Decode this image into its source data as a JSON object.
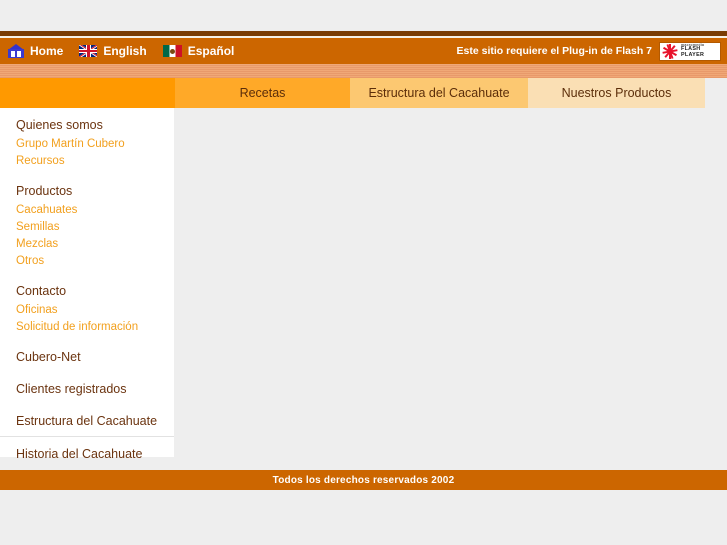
{
  "header": {
    "home_label": "Home",
    "english_label": "English",
    "spanish_label": "Español",
    "flash_note": "Este sitio requiere el Plug-in de Flash 7",
    "flash_badge": {
      "brand": "macromedia",
      "line1": "FLASH",
      "line2": "PLAYER"
    },
    "icons": {
      "home": "house-icon",
      "english": "uk-flag-icon",
      "spanish": "mexico-flag-icon",
      "flash": "flash-player-badge-icon"
    }
  },
  "nav": {
    "tabs": [
      {
        "label": "Recetas",
        "color": "#ffa928"
      },
      {
        "label": "Estructura del Cacahuate",
        "color": "#fcc871"
      },
      {
        "label": "Nuestros Productos",
        "color": "#fadfb4"
      }
    ]
  },
  "sidebar": {
    "groups": [
      {
        "heading": "Quienes somos",
        "links": [
          "Grupo Martín Cubero",
          "Recursos"
        ]
      },
      {
        "heading": "Productos",
        "links": [
          "Cacahuates",
          "Semillas",
          "Mezclas",
          "Otros"
        ]
      },
      {
        "heading": "Contacto",
        "links": [
          "Oficinas",
          "Solicitud de información"
        ]
      }
    ],
    "standalone": [
      "Cubero-Net",
      "Clientes registrados",
      "Estructura del Cacahuate"
    ],
    "after_divider": [
      "Historia del Cacahuate"
    ]
  },
  "footer": {
    "copyright": "Todos los derechos reservados 2002"
  },
  "colors": {
    "header_bar": "#cc6600",
    "nav_base": "#ff9900",
    "heading_text": "#6b3410",
    "link_text": "#f2a01e",
    "content_bg": "#eeeeee",
    "top_rule": "#7a3d05"
  }
}
